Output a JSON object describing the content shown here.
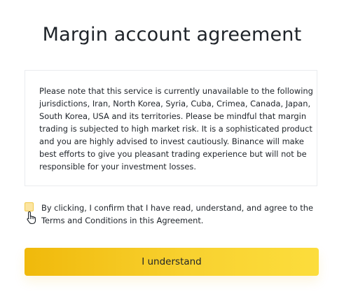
{
  "dialog": {
    "title": "Margin account agreement",
    "notice_text": "Please note that this service is currently unavailable to the following jurisdictions, Iran, North Korea, Syria, Cuba, Crimea, Canada, Japan, South Korea, USA and its territories. Please be mindful that margin trading is subjected to high market risk. It is a sophisticated product and you are highly advised to invest cautiously. Binance will make best efforts to give you pleasant trading experience but will not be responsible for your investment losses.",
    "confirm_text": "By clicking, I confirm that I have read, understand, and agree to the Terms and Conditions in this Agreement.",
    "confirm_checked": false,
    "button_label": "I understand"
  },
  "colors": {
    "accent": "#F0B90B",
    "accent_light": "#FCDD3C",
    "text": "#1E2329",
    "border": "#EAECEF",
    "checkbox_fill": "#FCE5A1"
  },
  "icons": {
    "cursor": "hand-pointer-icon"
  }
}
